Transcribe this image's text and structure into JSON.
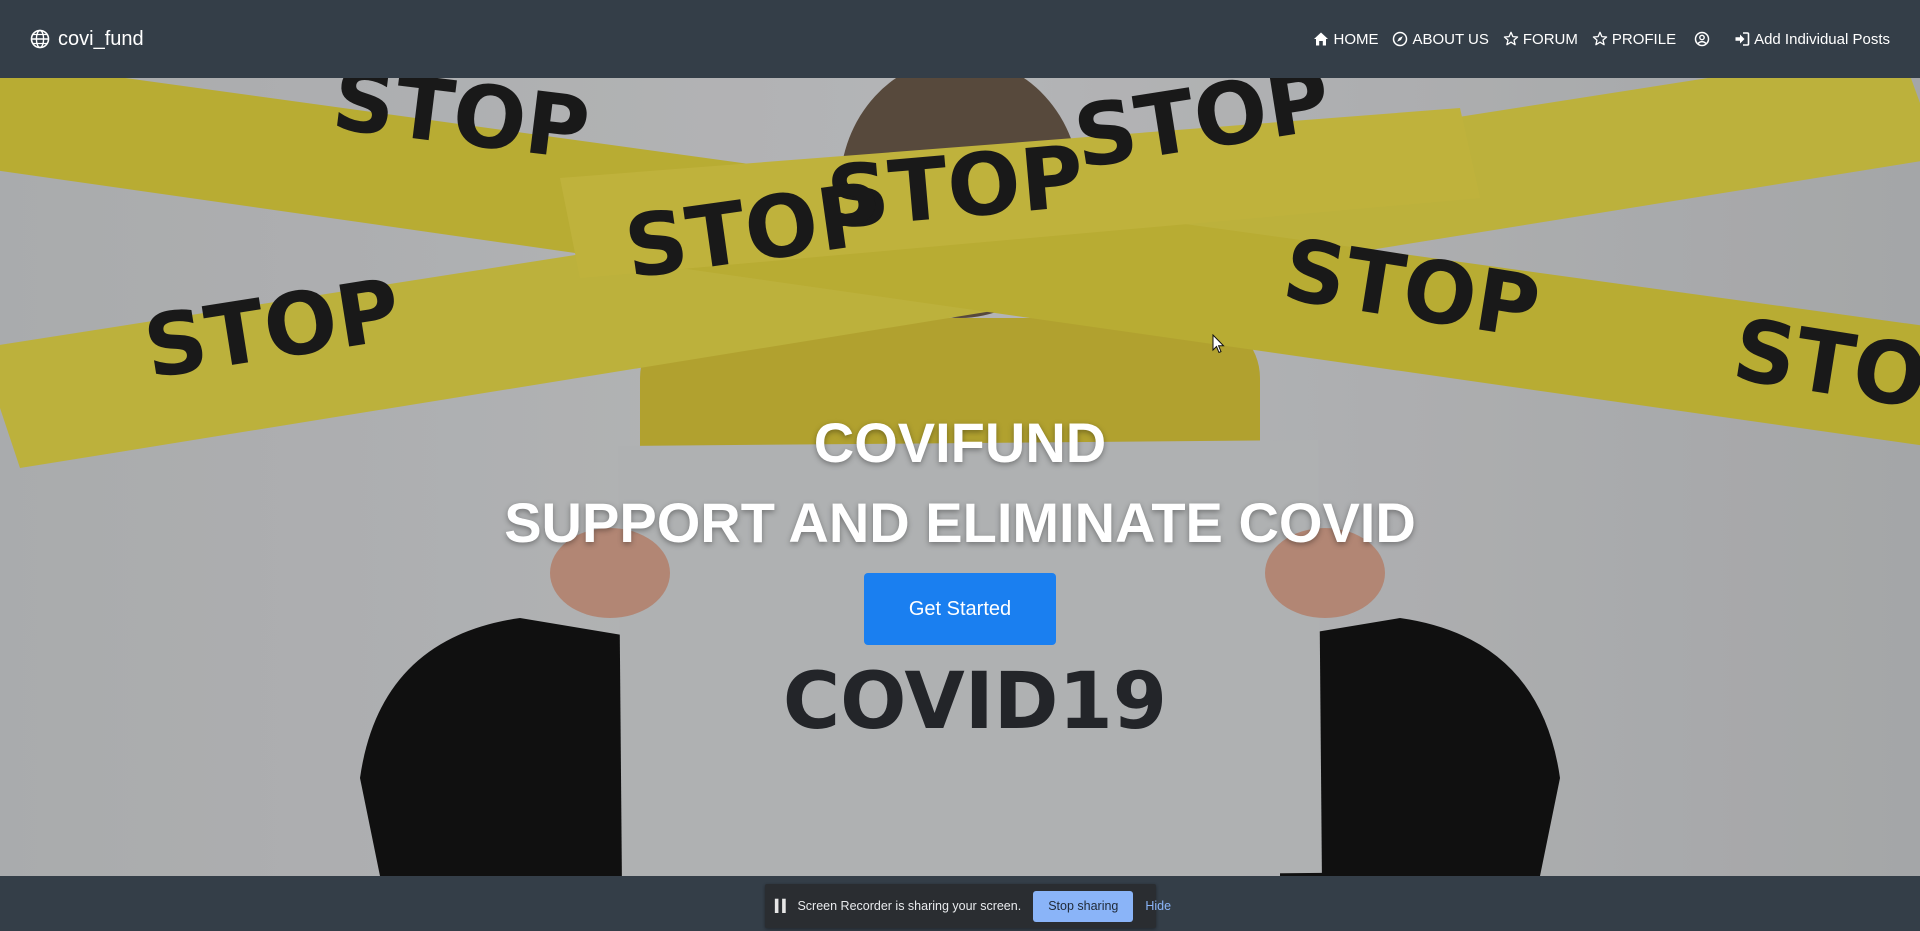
{
  "navbar": {
    "brand": "covi_fund",
    "brand_icon": "globe-icon",
    "items": [
      {
        "label": "HOME",
        "icon": "home-icon"
      },
      {
        "label": "ABOUT US",
        "icon": "compass-icon"
      },
      {
        "label": "FORUM",
        "icon": "star-icon"
      },
      {
        "label": "PROFILE",
        "icon": "star-icon"
      },
      {
        "label": "",
        "icon": "user-circle-icon"
      },
      {
        "label": "Add Individual Posts",
        "icon": "sign-in-icon"
      }
    ]
  },
  "hero": {
    "title_line1": "COVIFUND",
    "title_line2": "SUPPORT AND ELIMINATE COVID",
    "cta_label": "Get Started",
    "photo_text": {
      "tape_word": "STOP",
      "sign_text": "COVID19"
    }
  },
  "screen_share": {
    "message": "Screen Recorder is sharing your screen.",
    "stop_label": "Stop sharing",
    "hide_label": "Hide"
  },
  "colors": {
    "navbar_bg": "#343e48",
    "cta_bg": "#1a7ff0",
    "tape_yellow": "#e6d84a",
    "stop_btn_bg": "#8ab4f8"
  }
}
